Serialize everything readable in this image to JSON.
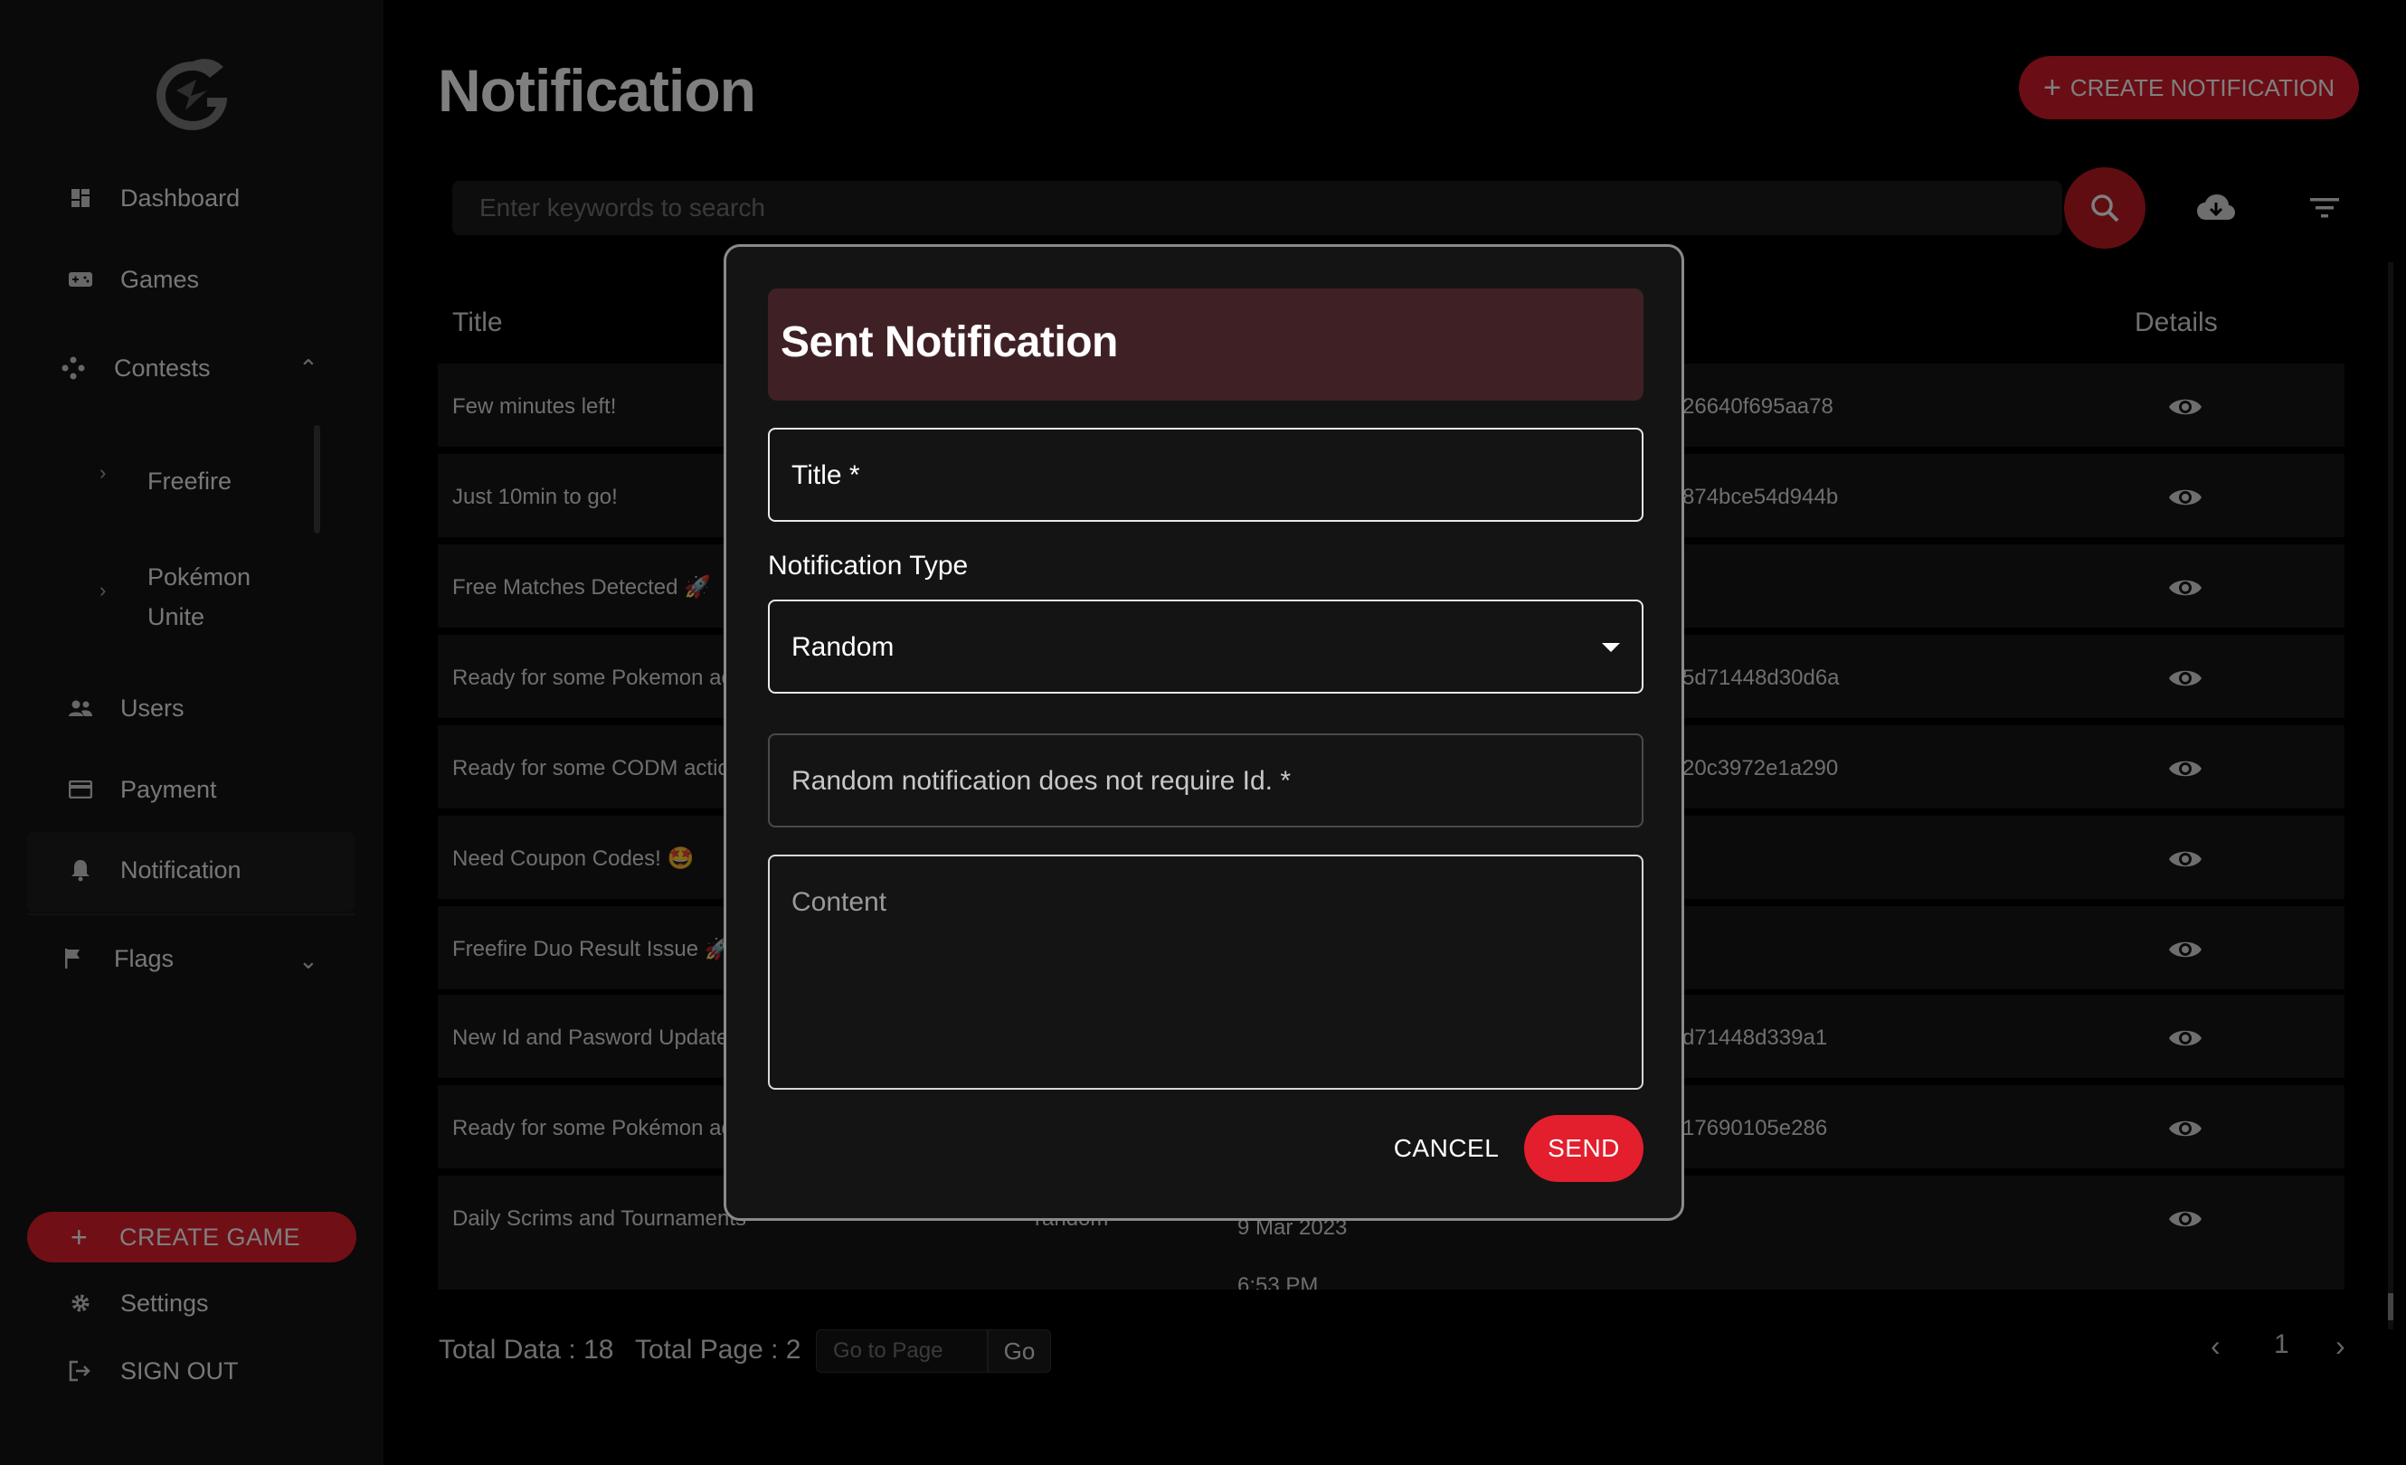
{
  "sidebar": {
    "items": [
      {
        "label": "Dashboard",
        "icon": "dashboard-icon"
      },
      {
        "label": "Games",
        "icon": "gamepad-icon"
      },
      {
        "label": "Contests",
        "icon": "contests-icon"
      },
      {
        "label": "Users",
        "icon": "users-icon"
      },
      {
        "label": "Payment",
        "icon": "card-icon"
      },
      {
        "label": "Notification",
        "icon": "bell-icon"
      },
      {
        "label": "Flags",
        "icon": "flag-icon"
      }
    ],
    "contest_subitems": [
      {
        "label": "Freefire"
      },
      {
        "label": "Pokémon",
        "label2": "Unite"
      }
    ],
    "create_game_label": "CREATE GAME",
    "settings_label": "Settings",
    "signout_label": "SIGN OUT"
  },
  "header": {
    "title": "Notification",
    "create_label": "CREATE NOTIFICATION"
  },
  "search": {
    "placeholder": "Enter keywords to search"
  },
  "table": {
    "columns": {
      "title": "Title",
      "details": "Details"
    },
    "rows": [
      {
        "title": "Few minutes left!",
        "type": "",
        "date": "",
        "id": "26640f695aa78"
      },
      {
        "title": "Just 10min to go!",
        "type": "",
        "date": "",
        "id": "874bce54d944b"
      },
      {
        "title": "Free Matches Detected 🚀",
        "type": "",
        "date": "",
        "id": ""
      },
      {
        "title": "Ready for some Pokemon ac",
        "type": "",
        "date": "",
        "id": "5d71448d30d6a"
      },
      {
        "title": "Ready for some CODM actio",
        "type": "",
        "date": "",
        "id": "20c3972e1a290"
      },
      {
        "title": "Need Coupon Codes! 🤩",
        "type": "",
        "date": "",
        "id": ""
      },
      {
        "title": "Freefire Duo Result Issue 🚀",
        "type": "",
        "date": "",
        "id": ""
      },
      {
        "title": "New Id and Pasword Update",
        "type": "",
        "date": "",
        "id": "d71448d339a1"
      },
      {
        "title": "Ready for some Pokémon ac",
        "type": "",
        "date": "",
        "id": "17690105e286"
      },
      {
        "title": "Daily Scrims and Tournaments",
        "type": "random",
        "date": "9 Mar 2023",
        "date2": "6:53 PM",
        "id": ""
      }
    ]
  },
  "footer": {
    "total_data": "Total Data : 18",
    "total_page": "Total Page : 2",
    "goto_placeholder": "Go to Page",
    "go_label": "Go",
    "current_page": "1"
  },
  "modal": {
    "title": "Sent Notification",
    "title_field_placeholder": "Title *",
    "type_label": "Notification Type",
    "type_value": "Random",
    "id_placeholder": "Random notification does not require Id. *",
    "content_placeholder": "Content",
    "cancel_label": "CANCEL",
    "send_label": "SEND"
  },
  "colors": {
    "accent": "#e31e2d",
    "modal_header": "#3f2125",
    "background": "#000000",
    "sidebar": "#141414"
  }
}
